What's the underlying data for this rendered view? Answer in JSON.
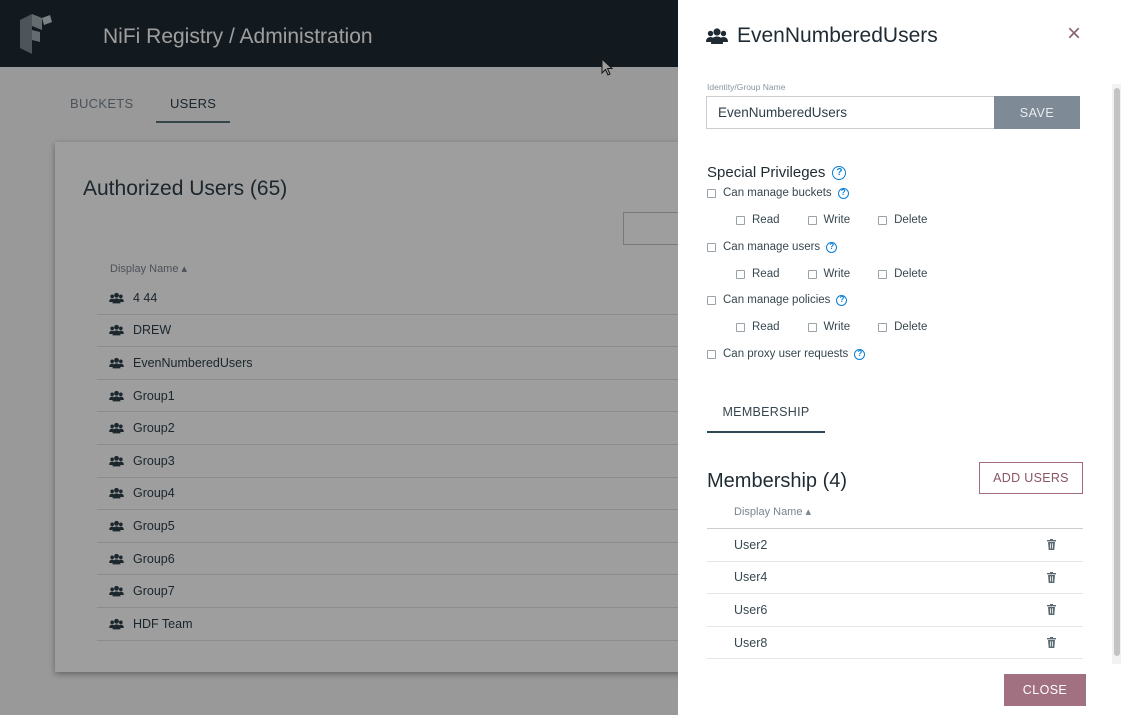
{
  "app": {
    "title": "NiFi Registry / Administration",
    "tabs": [
      {
        "label": "BUCKETS",
        "active": false
      },
      {
        "label": "USERS",
        "active": true
      }
    ],
    "card_title": "Authorized Users (65)",
    "table_header": "Display Name",
    "rows": [
      "4 44",
      "DREW",
      "EvenNumberedUsers",
      "Group1",
      "Group2",
      "Group3",
      "Group4",
      "Group5",
      "Group6",
      "Group7",
      "HDF Team"
    ]
  },
  "panel": {
    "title": "EvenNumberedUsers",
    "icon": "group-icon",
    "close_glyph": "×",
    "name_label": "Identity/Group Name",
    "name_value": "EvenNumberedUsers",
    "save_label": "SAVE",
    "privileges_title": "Special Privileges",
    "privileges": {
      "buckets": {
        "label": "Can manage buckets",
        "read": "Read",
        "write": "Write",
        "delete": "Delete"
      },
      "users": {
        "label": "Can manage users",
        "read": "Read",
        "write": "Write",
        "delete": "Delete"
      },
      "policies": {
        "label": "Can manage policies",
        "read": "Read",
        "write": "Write",
        "delete": "Delete"
      },
      "proxy": {
        "label": "Can proxy user requests"
      }
    },
    "membership_tab": "MEMBERSHIP",
    "membership_title": "Membership (4)",
    "add_users_label": "ADD USERS",
    "membership_header": "Display Name",
    "members": [
      "User2",
      "User4",
      "User6",
      "User8"
    ],
    "close_label": "CLOSE"
  },
  "colors": {
    "topbar": "#1f2b33",
    "accent": "#a27181",
    "help": "#0a7fd6",
    "save": "#7e8b96"
  }
}
